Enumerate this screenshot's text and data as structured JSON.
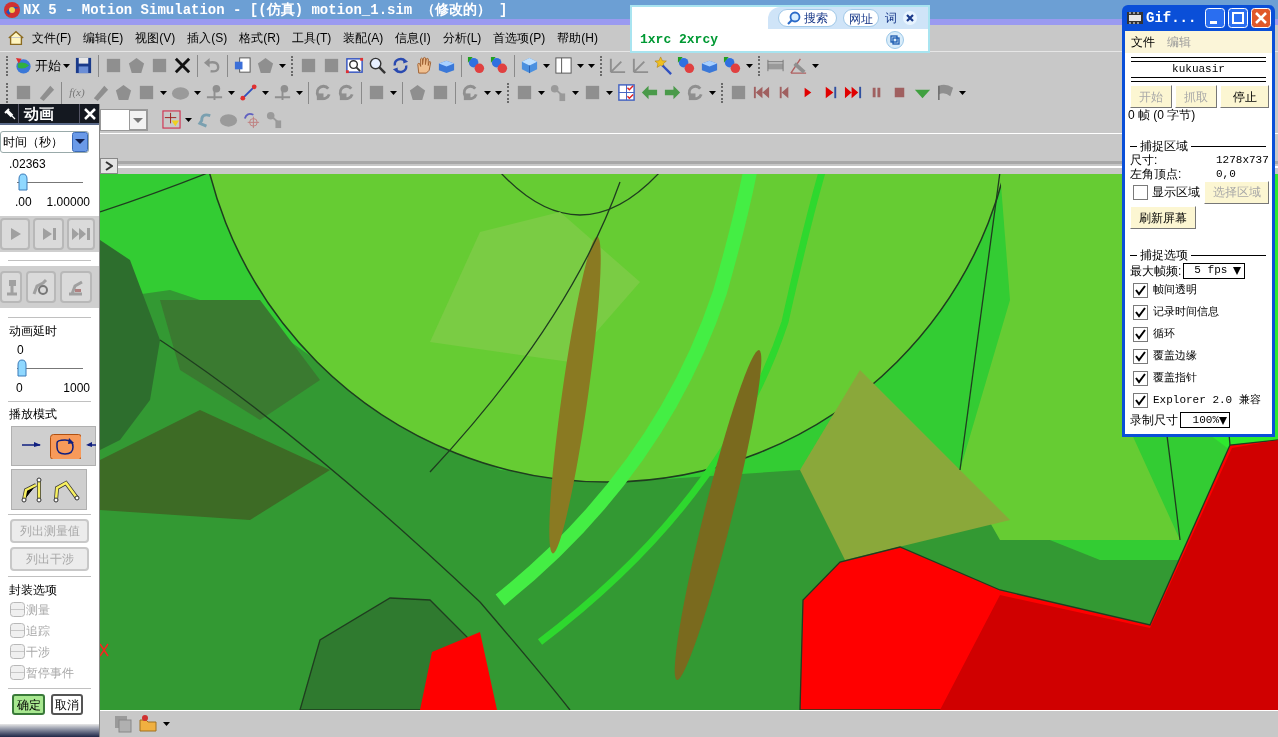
{
  "window": {
    "title": "NX 5 - Motion Simulation - [(仿真) motion_1.sim （修改的） ]"
  },
  "menu_bar": {
    "items": [
      "文件(F)",
      "编辑(E)",
      "视图(V)",
      "插入(S)",
      "格式(R)",
      "工具(T)",
      "装配(A)",
      "信息(I)",
      "分析(L)",
      "首选项(P)",
      "帮助(H)"
    ]
  },
  "toolbar": {
    "start_button": "开始",
    "function_button": "f(x)"
  },
  "search_popup": {
    "search_button": "搜索",
    "links": [
      "网址",
      "词"
    ],
    "text": "1xrc 2xrcy"
  },
  "animation_panel": {
    "title": "动画",
    "time_unit": "时间（秒）",
    "time_slider": {
      "reading": ".02363",
      "level": 0.02,
      "min": ".00",
      "max": "1.00000"
    },
    "delay_label": "动画延时",
    "delay_slider": {
      "reading": "0",
      "level": 0,
      "min": "0",
      "max": "1000"
    },
    "play_mode_label": "播放模式",
    "play_modes": [
      {
        "selected": false
      },
      {
        "selected": true
      },
      {
        "selected": false
      }
    ],
    "list_buttons": [
      {
        "label": "列出测量值",
        "disabled": true
      },
      {
        "label": "列出干涉",
        "disabled": true
      }
    ],
    "package_label": "封装选项",
    "package_options": [
      {
        "label": "测量",
        "checked": false,
        "disabled": true
      },
      {
        "label": "追踪",
        "checked": false,
        "disabled": true
      },
      {
        "label": "干涉",
        "checked": false,
        "disabled": true
      },
      {
        "label": "暂停事件",
        "checked": false,
        "disabled": true
      }
    ],
    "ok_button": "确定",
    "cancel_button": "取消"
  },
  "gif_window": {
    "title": "Gif...",
    "menu": [
      {
        "label": "文件",
        "disabled": false
      },
      {
        "label": "编辑",
        "disabled": true
      }
    ],
    "author": "kukuasir",
    "buttons": [
      {
        "label": "开始",
        "disabled": true
      },
      {
        "label": "抓取",
        "disabled": true
      },
      {
        "label": "停止",
        "disabled": false
      }
    ],
    "status": "0 帧 (0 字节)",
    "capture_area": {
      "heading": "捕捉区域",
      "size_label": "尺寸:",
      "size_value": "1278x737",
      "origin_label": "左角顶点:",
      "origin_value": "0,0",
      "show_area": {
        "label": "显示区域",
        "checked": false
      },
      "select_button": {
        "label": "选择区域",
        "disabled": true
      },
      "refresh_button": "刷新屏幕"
    },
    "capture_options": {
      "heading": "捕捉选项",
      "frame_rate_label": "最大帧频:",
      "frame_rate": "5 fps",
      "options": [
        {
          "label": "帧间透明",
          "checked": true
        },
        {
          "label": "记录时间信息",
          "checked": true
        },
        {
          "label": "循环",
          "checked": true
        },
        {
          "label": "覆盖边缘",
          "checked": true
        },
        {
          "label": "覆盖指针",
          "checked": true
        },
        {
          "label": "Explorer 2.0 兼容",
          "checked": true
        }
      ],
      "record_size_label": "录制尺寸",
      "record_size": "100%"
    }
  }
}
